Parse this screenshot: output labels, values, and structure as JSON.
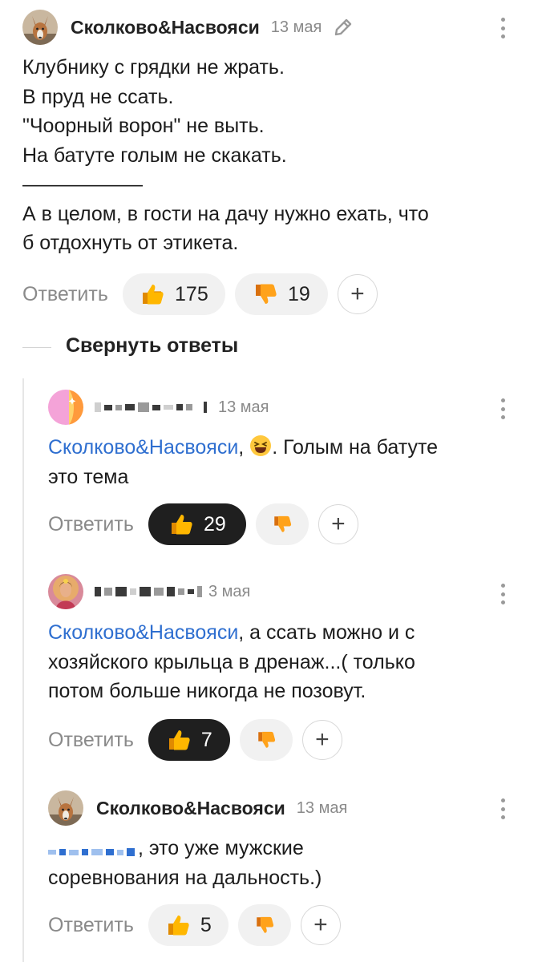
{
  "comments": [
    {
      "author": "Сколково&Насвояси",
      "date": "13 мая",
      "lines": [
        "Клубнику с грядки не жрать.",
        "В пруд не ссать.",
        "\"Чоорный ворон\" не выть.",
        "На батуте голым не скакать.",
        "——————",
        "А в целом, в гости на дачу нужно ехать, что",
        "б отдохнуть от этикета."
      ],
      "reply_label": "Ответить",
      "likes": "175",
      "dislikes": "19"
    },
    {
      "author": "",
      "date": "13 мая",
      "mention": "Сколково&Насвояси",
      "line1_rest": ". Голым на батуте",
      "line2": "это тема",
      "reply_label": "Ответить",
      "likes": "29",
      "dislikes": ""
    },
    {
      "author": "",
      "date": "3 мая",
      "mention": "Сколково&Насвояси",
      "line1_rest": ", а ссать можно и с",
      "line2": "хозяйского крыльца в дренаж...( только",
      "line3": "потом больше никогда не позовут.",
      "reply_label": "Ответить",
      "likes": "7",
      "dislikes": ""
    },
    {
      "author": "Сколково&Насвояси",
      "date": "13 мая",
      "line1_rest": ", это уже мужские",
      "line2": "соревнования на дальность.)",
      "reply_label": "Ответить",
      "likes": "5",
      "dislikes": ""
    }
  ],
  "collapse_label": "Свернуть ответы",
  "plus_label": "+",
  "colors": {
    "mention": "#2f6fd0",
    "active_pill": "#1f1f1f",
    "pill": "#f1f1f1",
    "muted": "#8a8a8a"
  },
  "icons": {
    "like": "thumbs-up-icon",
    "dislike": "thumbs-down-icon",
    "edit": "pencil-icon",
    "menu": "more-vertical-icon"
  }
}
